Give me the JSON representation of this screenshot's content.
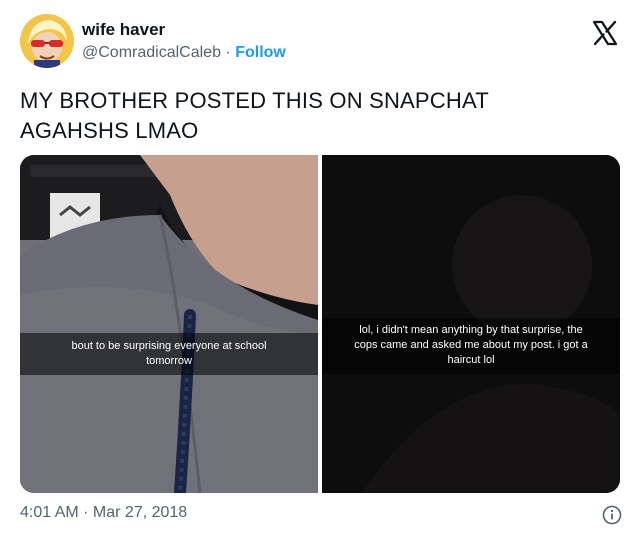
{
  "author": {
    "display_name": "wife haver",
    "handle": "@ComradicalCaleb",
    "separator": "·",
    "follow_label": "Follow"
  },
  "brand": {
    "icon": "x-logo-icon"
  },
  "tweet": {
    "text_line1": "MY BROTHER POSTED THIS ON SNAPCHAT",
    "text_line2": "AGAHSHS LMAO"
  },
  "media": {
    "left_caption_line1": "bout to be surprising everyone at school",
    "left_caption_line2": "tomorrow",
    "right_caption_line1": "lol, i didn't mean anything by that surprise, the",
    "right_caption_line2": "cops came and asked me about my post. i got a",
    "right_caption_line3": "haircut lol"
  },
  "footer": {
    "timestamp": "4:01 AM · Mar 27, 2018",
    "info_icon": "info-icon"
  },
  "colors": {
    "text": "#0f1419",
    "secondary": "#536471",
    "accent": "#1d9bf0"
  }
}
